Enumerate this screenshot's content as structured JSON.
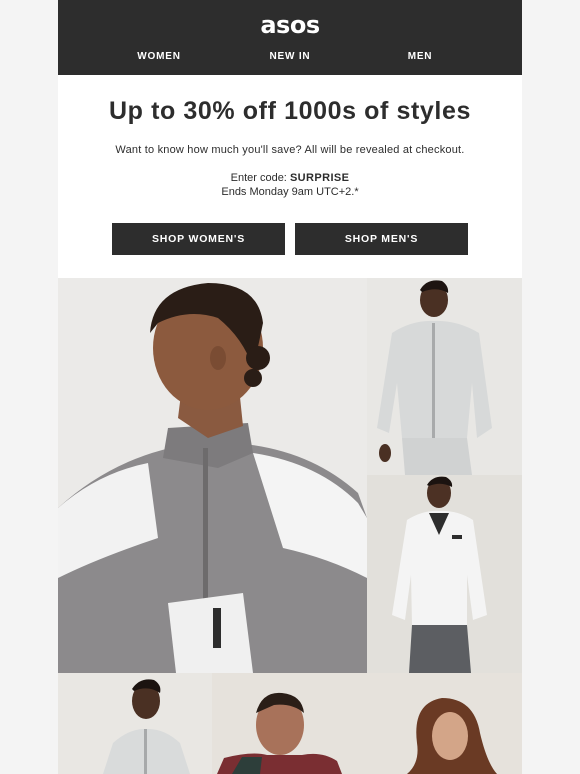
{
  "header": {
    "logo": "asos",
    "nav": [
      "WOMEN",
      "NEW IN",
      "MEN"
    ]
  },
  "hero": {
    "headline": "Up to 30% off 1000s of styles",
    "subtext": "Want to know how much you'll save? All will be revealed at checkout.",
    "code_prefix": "Enter code:",
    "code": "SURPRISE",
    "ends": "Ends Monday 9am UTC+2.*",
    "buttons": {
      "women": "SHOP WOMEN'S",
      "men": "SHOP MEN'S"
    }
  },
  "colors": {
    "header_bg": "#2d2d2d",
    "button_bg": "#2d2d2d",
    "page_bg": "#f4f4f4",
    "text": "#2d2d2d"
  },
  "images": {
    "main": "model-grey-white-windbreaker-closeup",
    "top_right": "model-light-grey-zip-jacket",
    "middle_right": "model-white-half-zip-jacket",
    "bottom_left": "model-light-half-zip",
    "bottom_right": "two-models-smiling"
  }
}
